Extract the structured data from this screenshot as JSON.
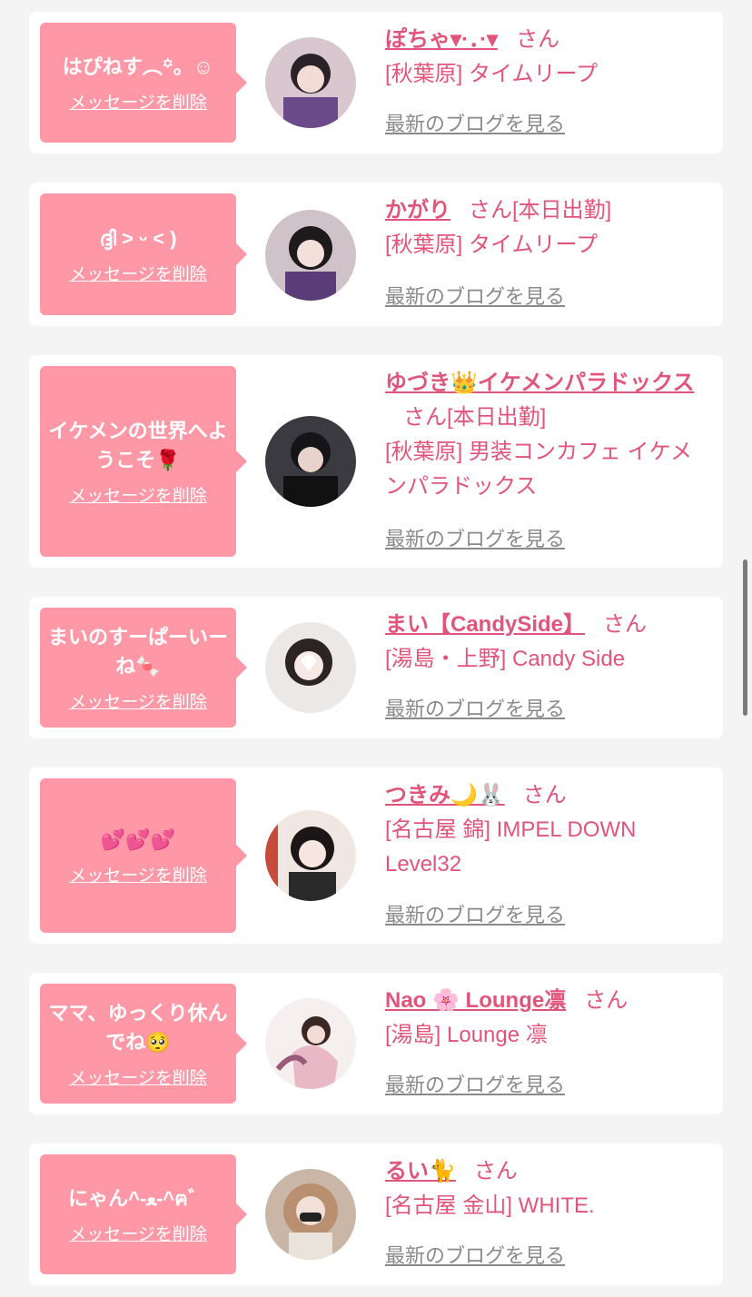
{
  "common": {
    "san": "さん",
    "delete_label": "メッセージを削除",
    "blog_label": "最新のブログを見る"
  },
  "entries": [
    {
      "message": "はぴねす︵꙳。☺",
      "name": "ぽちゃ▾·．·▾",
      "status": "",
      "shop": "[秋葉原] タイムリープ"
    },
    {
      "message": "ദ്ദി ˃ ᵕ ˂ )",
      "name": "かがり",
      "status": "[本日出勤]",
      "shop": "[秋葉原] タイムリープ"
    },
    {
      "message": "イケメンの世界へようこそ🌹",
      "name": "ゆづき👑イケメンパラドックス",
      "status": "[本日出勤]",
      "shop": "[秋葉原] 男装コンカフェ イケメンパラドックス"
    },
    {
      "message": "まいのすーぱーいーね🍬",
      "name": "まい【CandySide】",
      "status": "",
      "shop": "[湯島・上野] Candy Side"
    },
    {
      "message": "💕💕💕",
      "name": "つきみ🌙🐰",
      "status": "",
      "shop": "[名古屋 錦] IMPEL DOWN Level32"
    },
    {
      "message": "ママ、ゆっくり休んでね🥺",
      "name": "Nao 🌸 Lounge凛",
      "status": "",
      "shop": "[湯島] Lounge 凛"
    },
    {
      "message": "にゃん^-ﻌ-^ฅ゛",
      "name": "るい🐈",
      "status": "",
      "shop": "[名古屋 金山] WHITE."
    }
  ]
}
